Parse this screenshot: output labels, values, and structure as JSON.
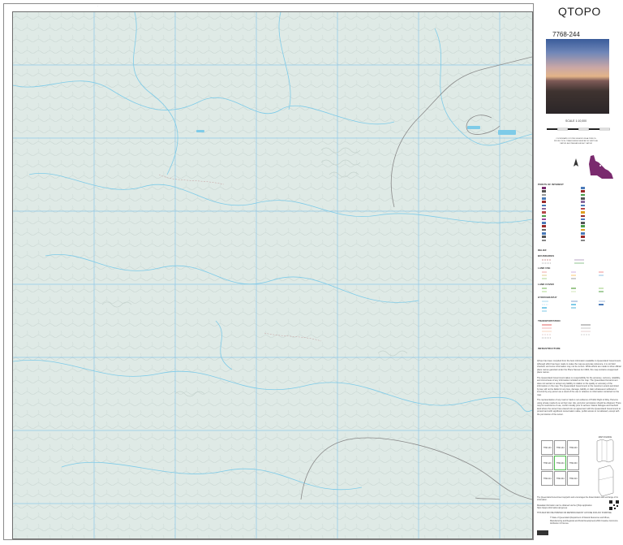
{
  "header": {
    "brand": "QTOPO",
    "sheet_id": "7768-244"
  },
  "map": {
    "scale": "SCALE 1:10,000",
    "scale_ticks": [
      "0",
      "200",
      "400",
      "600",
      "800",
      "1000"
    ],
    "colors": {
      "land": "#dfeae6",
      "water": "#7ecbe8",
      "grid": "#8fc8e8",
      "contour": "#8a8a8a",
      "road": "#f0a0a0"
    }
  },
  "inset_notes": "COORDINATE SYSTEM GDA2020 MGA ZONE 55 PROJECTION: TRANSVERSE MERCATOR VERTICAL DATUM: AUSTRALIAN HEIGHT DATUM",
  "legend": {
    "sections": [
      "POINTS OF INTEREST",
      "RELIEF",
      "BOUNDARIES",
      "LAND USE",
      "LAND COVER",
      "HYDROGRAPHY",
      "TRANSPORTATION",
      "INFRASTRUCTURE"
    ]
  },
  "notes": [
    "QTopo has been compiled from the best information available to Queensland Government. Although effort has been made to make the map as accurate reference, it is not field checked, and some information may not be current. While efforts are made to show official place names gazetted under the Place Names Act 1994, this map contains unapproved place names.",
    "The Queensland Government takes no responsibility for the accuracy, currency, reliability, and correctness of any information included on the map. The Queensland Government does not warrant or accept any liability in relation to the quality or accuracy of the information on the map. The Queensland Government to the maximum extent permitted by law, will not be liable for any loss, damage, liability or claim whatsoever suffered or incurred by any person as a result of the use or reliance on information contained on the map.",
    "The representation of any road or track is not evidence of Public Right of Way. Persons using private roads do so at their own risk, and prior permission should be obtained. There may be restrictions of use, confirm locally prior to access. Nature Refuges and freehold land where the owner has entered into an agreement with the Queensland Government to protect land with significant conservation value, public access is not allowed, except with the permission of the owner."
  ],
  "index_sheets": [
    "7768-143",
    "7768-144",
    "7768-243",
    "7768-244",
    "7768-343",
    "7768-344",
    "7768-113",
    "7768-214",
    "7768-313"
  ],
  "folding_label": "MAP FOLDING",
  "footer": [
    "The Queensland Government supports and encourages the dissemination and exchange of its information.",
    "Metadata information can be obtained via the QTopo application https://qtopo.information.qld.gov.au",
    "THIS MAP MAY BE PRINTED OR REPRODUCED BY ANYONE FOR ANY PURPOSE",
    "© State of Queensland (Department of Natural Resources and Mines, Manufacturing and Regional and Rural Development) 2024 Creative Commons Attribution 4.0 licence"
  ]
}
